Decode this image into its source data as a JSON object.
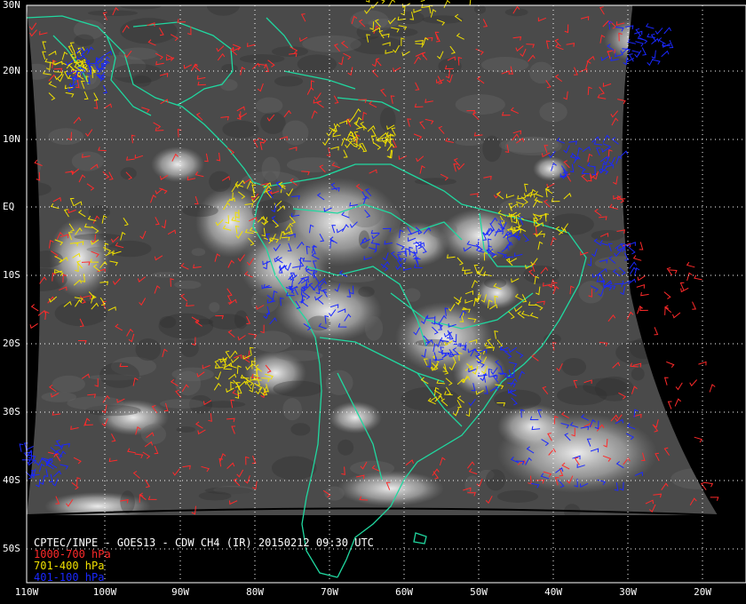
{
  "map": {
    "title": "CPTEC/INPE - GOES13 - CDW CH4 (IR) 20150212 09:30 UTC",
    "legend": [
      {
        "label": "1000-700 hPa",
        "color": "#ff2a2a"
      },
      {
        "label": "701-400 hPa",
        "color": "#f0e000"
      },
      {
        "label": "401-100 hPa",
        "color": "#1a28ff"
      }
    ],
    "lat_labels": [
      "30N",
      "20N",
      "10N",
      "EQ",
      "10S",
      "20S",
      "30S",
      "40S",
      "50S"
    ],
    "lon_labels": [
      "110W",
      "100W",
      "90W",
      "80W",
      "70W",
      "60W",
      "50W",
      "40W",
      "30W",
      "20W"
    ],
    "coastline_color": "#20d8a0",
    "gridline_color": "#ffffff",
    "background": "black"
  }
}
